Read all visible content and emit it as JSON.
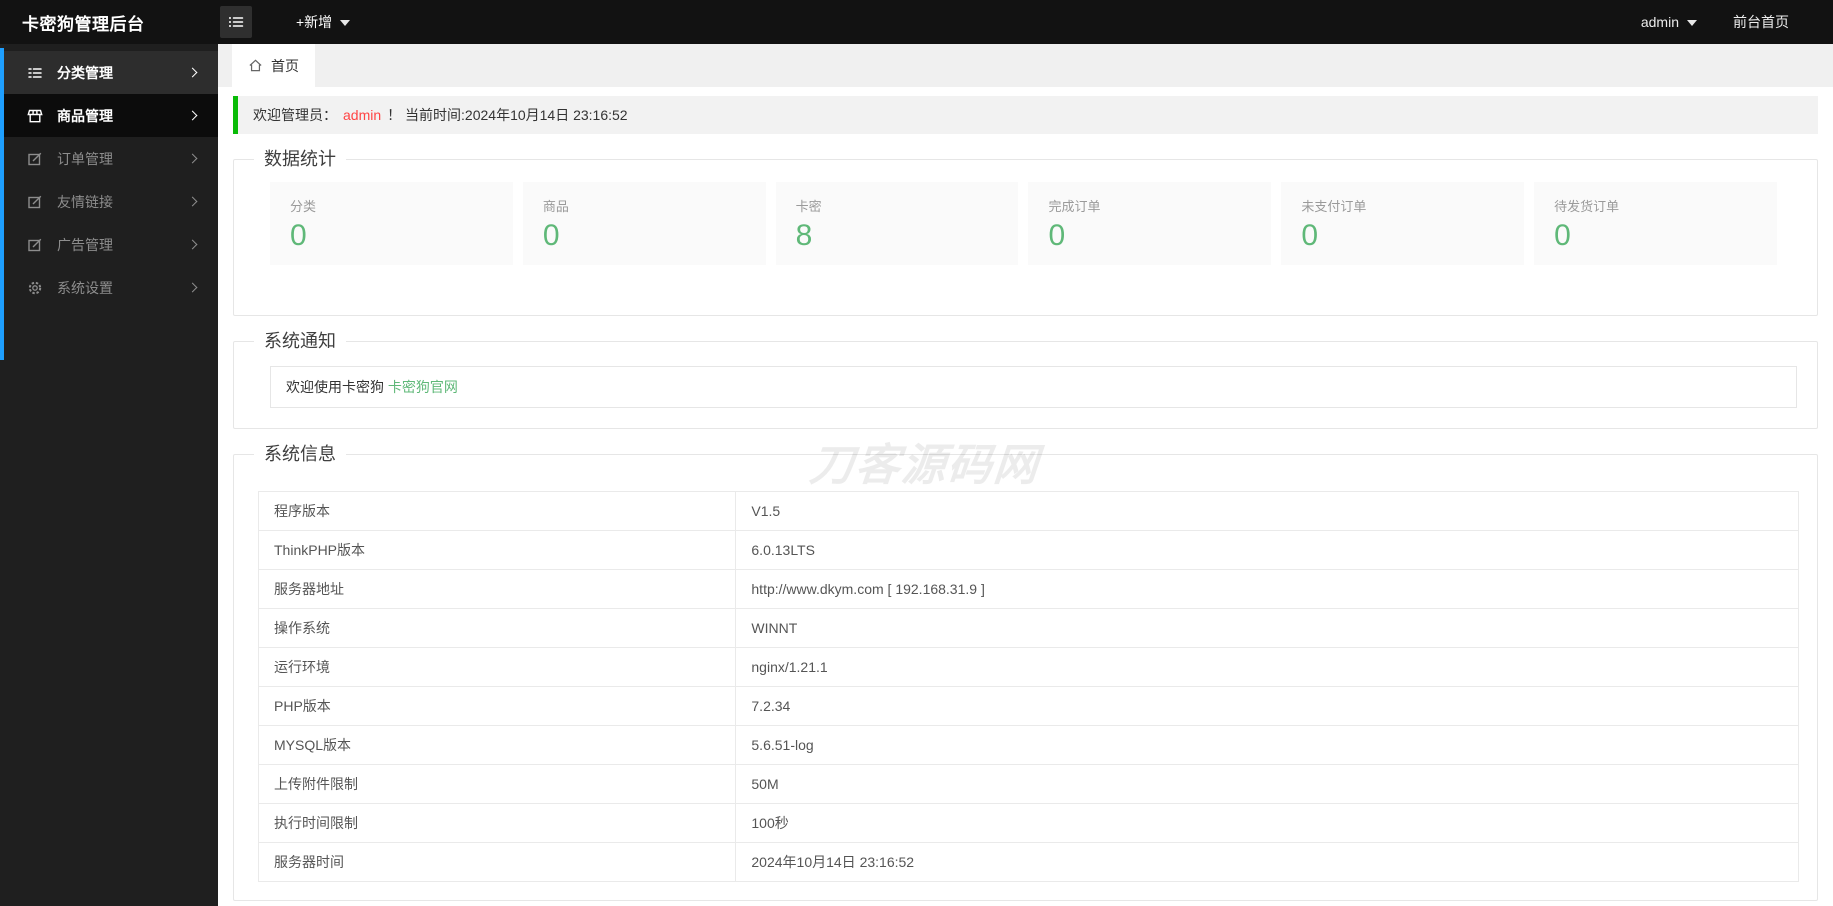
{
  "app": {
    "title": "卡密狗管理后台"
  },
  "topbar": {
    "new_label": "+新增",
    "user": "admin",
    "front_home": "前台首页"
  },
  "sidebar": {
    "items": [
      {
        "label": "分类管理",
        "icon": "list-icon",
        "state": "hovered"
      },
      {
        "label": "商品管理",
        "icon": "shop-icon",
        "state": "active"
      },
      {
        "label": "订单管理",
        "icon": "edit-icon",
        "state": "normal"
      },
      {
        "label": "友情链接",
        "icon": "edit-icon",
        "state": "normal"
      },
      {
        "label": "广告管理",
        "icon": "edit-icon",
        "state": "normal"
      },
      {
        "label": "系统设置",
        "icon": "gear-icon",
        "state": "normal"
      }
    ]
  },
  "tabs": {
    "home": "首页"
  },
  "alert": {
    "prefix": "欢迎管理员：",
    "user": "admin",
    "suffix": "！ 当前时间:2024年10月14日 23:16:52"
  },
  "stats": {
    "legend": "数据统计",
    "cards": [
      {
        "label": "分类",
        "value": "0"
      },
      {
        "label": "商品",
        "value": "0"
      },
      {
        "label": "卡密",
        "value": "8"
      },
      {
        "label": "完成订单",
        "value": "0"
      },
      {
        "label": "未支付订单",
        "value": "0"
      },
      {
        "label": "待发货订单",
        "value": "0"
      }
    ]
  },
  "notice": {
    "legend": "系统通知",
    "text": "欢迎使用卡密狗 ",
    "link": "卡密狗官网"
  },
  "sysinfo": {
    "legend": "系统信息",
    "rows": [
      [
        "程序版本",
        "V1.5"
      ],
      [
        "ThinkPHP版本",
        "6.0.13LTS"
      ],
      [
        "服务器地址",
        "http://www.dkym.com [ 192.168.31.9 ]"
      ],
      [
        "操作系统",
        "WINNT"
      ],
      [
        "运行环境",
        "nginx/1.21.1"
      ],
      [
        "PHP版本",
        "7.2.34"
      ],
      [
        "MYSQL版本",
        "5.6.51-log"
      ],
      [
        "上传附件限制",
        "50M"
      ],
      [
        "执行时间限制",
        "100秒"
      ],
      [
        "服务器时间",
        "2024年10月14日 23:16:52"
      ]
    ]
  },
  "watermark": "刀客源码网",
  "colors": {
    "green": "#5FB878",
    "alert_border": "#09BB07",
    "admin_red": "#ff4444",
    "scrollbar_blue": "#1E9FFF",
    "dark_bg": "#1f1f1f"
  }
}
